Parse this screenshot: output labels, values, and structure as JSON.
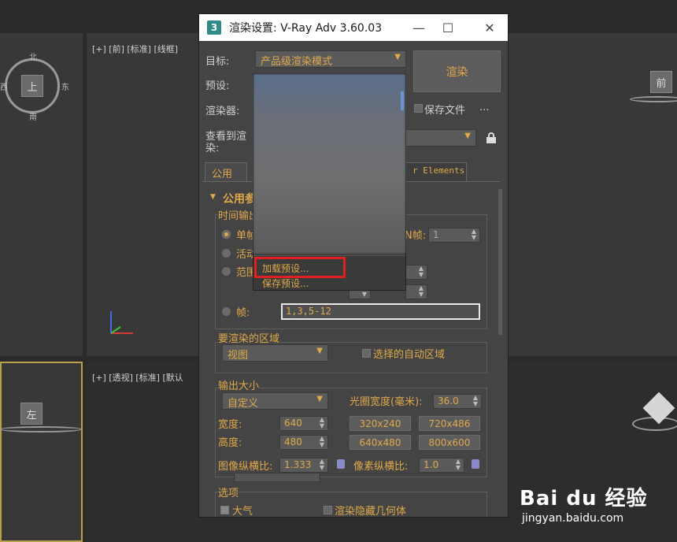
{
  "viewports": {
    "front_label": "[+] [前] [标准] [线框]",
    "persp_label": "[+] [透视] [标准] [默认",
    "top_cube": "上",
    "front_cube": "前",
    "left_cube": "左",
    "compass": {
      "n": "北",
      "s": "南",
      "e": "东",
      "w": "西"
    }
  },
  "dialog": {
    "icon_text": "3",
    "title": "渲染设置: V-Ray Adv 3.60.03",
    "minimize": "—",
    "maximize": "☐",
    "close": "✕",
    "target_label": "目标:",
    "target_value": "产品级渲染模式",
    "render_button": "渲染",
    "preset_label": "预设:",
    "renderer_label": "渲染器:",
    "save_file_label": "保存文件",
    "save_file_dots": "...",
    "view_label_1": "查看到渲",
    "view_label_2": "染:",
    "tabs": [
      "公用",
      "r Elements"
    ],
    "rollout_title": "公用参数",
    "time_output": "时间输出",
    "single": "单帧",
    "active": "活动",
    "range": "范围",
    "every_n": "每N帧:",
    "every_n_value": "1",
    "frames_label": "帧:",
    "frames_value": "1,3,5-12",
    "area_group": "要渲染的区域",
    "area_value": "视图",
    "auto_region": "选择的自动区域",
    "output_size": "输出大小",
    "output_preset": "自定义",
    "aperture_label": "光圈宽度(毫米):",
    "aperture_value": "36.0",
    "width_label": "宽度:",
    "width_value": "640",
    "height_label": "高度:",
    "height_value": "480",
    "presets": [
      "320x240",
      "720x486",
      "640x480",
      "800x600"
    ],
    "image_aspect_label": "图像纵横比:",
    "image_aspect_value": "1.333",
    "pixel_aspect_label": "像素纵横比:",
    "pixel_aspect_value": "1.0",
    "options": "选项",
    "atmosphere": "大气",
    "render_hidden": "渲染隐藏几何体"
  },
  "preset_menu": {
    "load_preset": "加载预设...",
    "save_preset": "保存预设..."
  },
  "watermark": {
    "logo": "Bai du 经验",
    "url": "jingyan.baidu.com"
  }
}
